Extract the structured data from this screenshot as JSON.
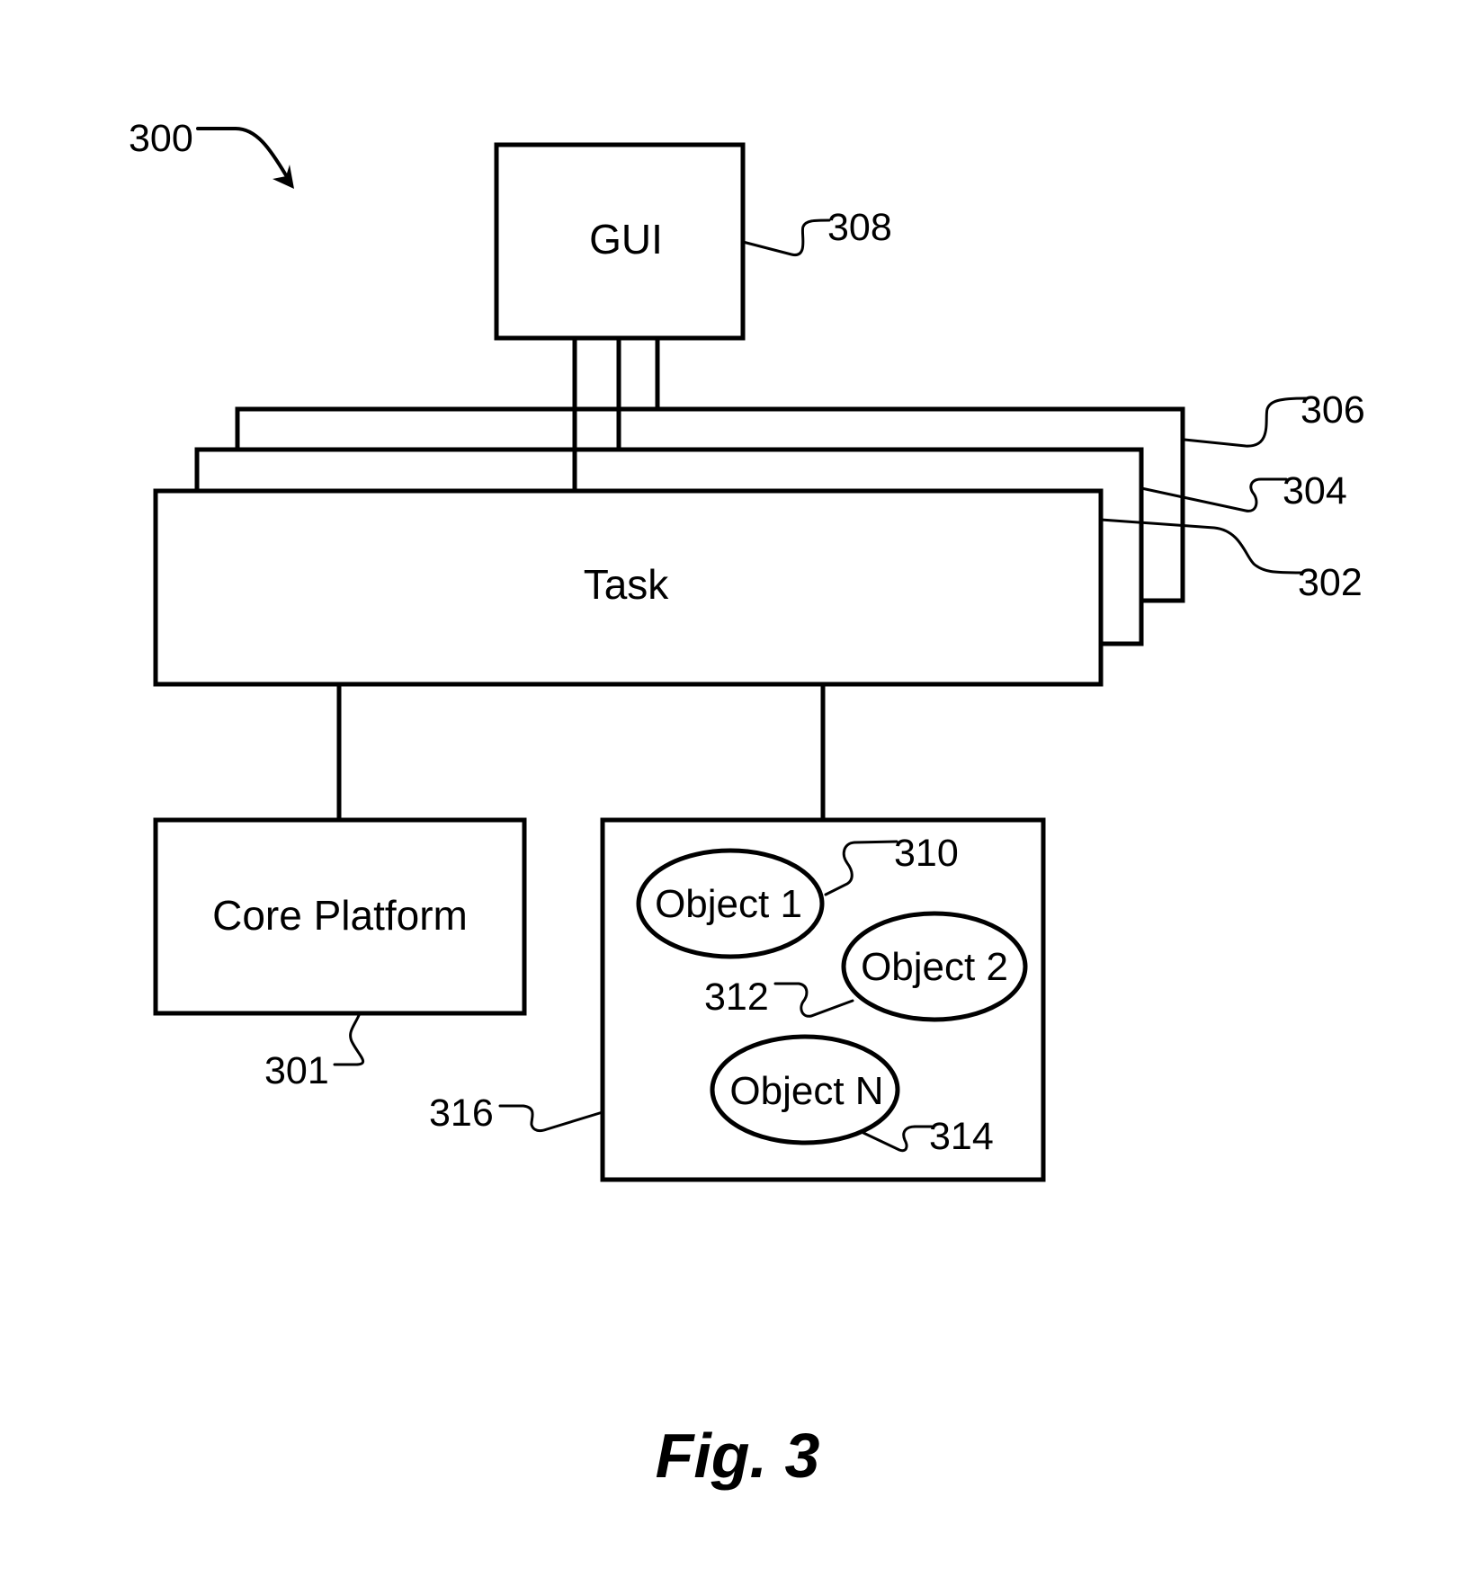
{
  "figure": {
    "caption": "Fig. 3",
    "reference": "300"
  },
  "blocks": {
    "gui": {
      "label": "GUI",
      "ref": "308"
    },
    "task": {
      "label": "Task",
      "ref": "302"
    },
    "task_layer_2": {
      "ref": "304"
    },
    "task_layer_3": {
      "ref": "306"
    },
    "core_platform": {
      "label": "Core Platform",
      "ref": "301"
    },
    "object_container": {
      "ref": "316"
    }
  },
  "objects": [
    {
      "label": "Object 1",
      "ref": "310"
    },
    {
      "label": "Object 2",
      "ref": "312"
    },
    {
      "label": "Object N",
      "ref": "314"
    }
  ],
  "colors": {
    "stroke": "#000000",
    "background": "#ffffff"
  }
}
